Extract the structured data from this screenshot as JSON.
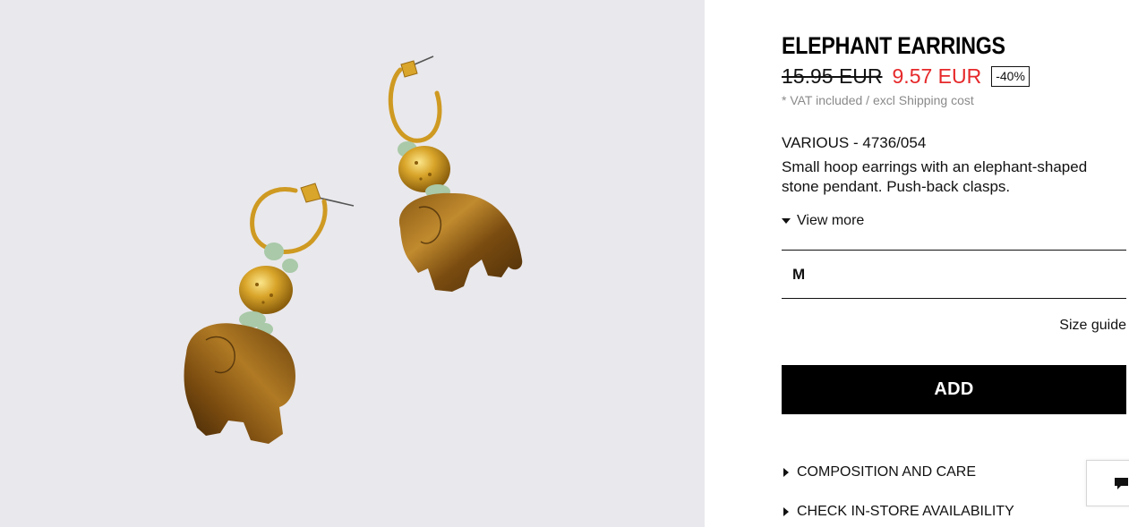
{
  "product": {
    "title": "ELEPHANT EARRINGS",
    "old_price": "15.95 EUR",
    "new_price": "9.57 EUR",
    "discount": "-40%",
    "vat_note": "* VAT included / excl Shipping cost",
    "reference": "VARIOUS - 4736/054",
    "description": "Small hoop earrings with an elephant-shaped stone pendant. Push-back clasps.",
    "view_more_label": "View more"
  },
  "size": {
    "selected": "M",
    "guide_label": "Size guide"
  },
  "actions": {
    "add_label": "ADD"
  },
  "accordions": [
    {
      "label": "COMPOSITION AND CARE"
    },
    {
      "label": "CHECK IN-STORE AVAILABILITY"
    }
  ],
  "colors": {
    "sale_price": "#e6282a",
    "image_background": "#e9e8ec",
    "add_button": "#000000"
  },
  "icons": {
    "view_more": "triangle-down-icon",
    "accordion": "triangle-right-icon",
    "chat": "chat-bubble-icon"
  }
}
